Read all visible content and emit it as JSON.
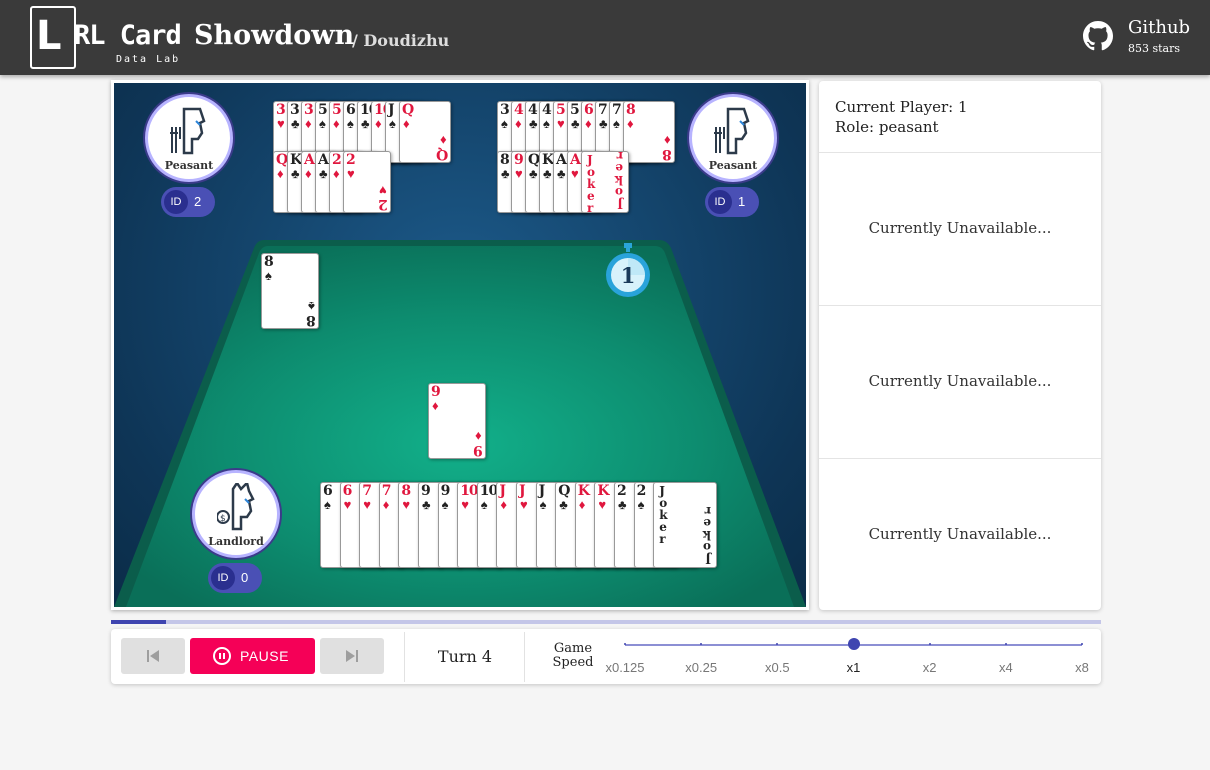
{
  "header": {
    "logo_mark": "L",
    "logo_text": "RL Card",
    "logo_sub": "Data Lab",
    "title": "Showdown",
    "subtitle": "/ Doudizhu",
    "github_label": "Github",
    "github_stars": "853 stars"
  },
  "players": [
    {
      "role": "Landlord",
      "id_label": "ID",
      "id": "0"
    },
    {
      "role": "Peasant",
      "id_label": "ID",
      "id": "1"
    },
    {
      "role": "Peasant",
      "id_label": "ID",
      "id": "2"
    }
  ],
  "hands": {
    "player2_row1": [
      {
        "rank": "3",
        "suit": "♥",
        "color": "red"
      },
      {
        "rank": "3",
        "suit": "♣",
        "color": "black"
      },
      {
        "rank": "3",
        "suit": "♦",
        "color": "red"
      },
      {
        "rank": "5",
        "suit": "♠",
        "color": "black"
      },
      {
        "rank": "5",
        "suit": "♦",
        "color": "red"
      },
      {
        "rank": "6",
        "suit": "♠",
        "color": "black"
      },
      {
        "rank": "10",
        "suit": "♣",
        "color": "black"
      },
      {
        "rank": "10",
        "suit": "♦",
        "color": "red"
      },
      {
        "rank": "J",
        "suit": "♠",
        "color": "black"
      },
      {
        "rank": "Q",
        "suit": "♦",
        "color": "red"
      }
    ],
    "player2_row2": [
      {
        "rank": "Q",
        "suit": "♦",
        "color": "red"
      },
      {
        "rank": "K",
        "suit": "♣",
        "color": "black"
      },
      {
        "rank": "A",
        "suit": "♦",
        "color": "red"
      },
      {
        "rank": "A",
        "suit": "♣",
        "color": "black"
      },
      {
        "rank": "2",
        "suit": "♦",
        "color": "red"
      },
      {
        "rank": "2",
        "suit": "♥",
        "color": "red"
      }
    ],
    "player1_row1": [
      {
        "rank": "3",
        "suit": "♠",
        "color": "black"
      },
      {
        "rank": "4",
        "suit": "♦",
        "color": "red"
      },
      {
        "rank": "4",
        "suit": "♣",
        "color": "black"
      },
      {
        "rank": "4",
        "suit": "♠",
        "color": "black"
      },
      {
        "rank": "5",
        "suit": "♥",
        "color": "red"
      },
      {
        "rank": "5",
        "suit": "♣",
        "color": "black"
      },
      {
        "rank": "6",
        "suit": "♦",
        "color": "red"
      },
      {
        "rank": "7",
        "suit": "♣",
        "color": "black"
      },
      {
        "rank": "7",
        "suit": "♠",
        "color": "black"
      },
      {
        "rank": "8",
        "suit": "♦",
        "color": "red"
      }
    ],
    "player1_row2": [
      {
        "rank": "8",
        "suit": "♣",
        "color": "black"
      },
      {
        "rank": "9",
        "suit": "♥",
        "color": "red"
      },
      {
        "rank": "Q",
        "suit": "♣",
        "color": "black"
      },
      {
        "rank": "K",
        "suit": "♣",
        "color": "black"
      },
      {
        "rank": "A",
        "suit": "♣",
        "color": "black"
      },
      {
        "rank": "A",
        "suit": "♥",
        "color": "red"
      },
      {
        "rank": "Joker",
        "suit": "",
        "color": "red",
        "joker": true
      }
    ],
    "player0": [
      {
        "rank": "6",
        "suit": "♠",
        "color": "black"
      },
      {
        "rank": "6",
        "suit": "♥",
        "color": "red"
      },
      {
        "rank": "7",
        "suit": "♥",
        "color": "red"
      },
      {
        "rank": "7",
        "suit": "♦",
        "color": "red"
      },
      {
        "rank": "8",
        "suit": "♥",
        "color": "red"
      },
      {
        "rank": "9",
        "suit": "♣",
        "color": "black"
      },
      {
        "rank": "9",
        "suit": "♠",
        "color": "black"
      },
      {
        "rank": "10",
        "suit": "♥",
        "color": "red"
      },
      {
        "rank": "10",
        "suit": "♠",
        "color": "black"
      },
      {
        "rank": "J",
        "suit": "♦",
        "color": "red"
      },
      {
        "rank": "J",
        "suit": "♥",
        "color": "red"
      },
      {
        "rank": "J",
        "suit": "♠",
        "color": "black"
      },
      {
        "rank": "Q",
        "suit": "♣",
        "color": "black"
      },
      {
        "rank": "K",
        "suit": "♦",
        "color": "red"
      },
      {
        "rank": "K",
        "suit": "♥",
        "color": "red"
      },
      {
        "rank": "2",
        "suit": "♣",
        "color": "black"
      },
      {
        "rank": "2",
        "suit": "♠",
        "color": "black"
      },
      {
        "rank": "Joker",
        "suit": "",
        "color": "black",
        "joker": true
      }
    ]
  },
  "played": {
    "player2": {
      "rank": "8",
      "suit": "♠",
      "color": "black"
    },
    "player0": {
      "rank": "9",
      "suit": "♦",
      "color": "red"
    }
  },
  "timer": "1",
  "panel": {
    "current_player": "Current Player: 1",
    "role": "Role: peasant",
    "unavailable_1": "Currently Unavailable...",
    "unavailable_2": "Currently Unavailable...",
    "unavailable_3": "Currently Unavailable..."
  },
  "progress_fraction": 0.056,
  "controls": {
    "pause_label": "PAUSE",
    "turn": "Turn 4",
    "speed_label": "Game Speed",
    "speeds": [
      "x0.125",
      "x0.25",
      "x0.5",
      "x1",
      "x2",
      "x4",
      "x8"
    ],
    "active_speed": "x1"
  },
  "colors": {
    "accent": "#3f45b0",
    "pause": "#f50057",
    "table": "#0f8a6c"
  }
}
